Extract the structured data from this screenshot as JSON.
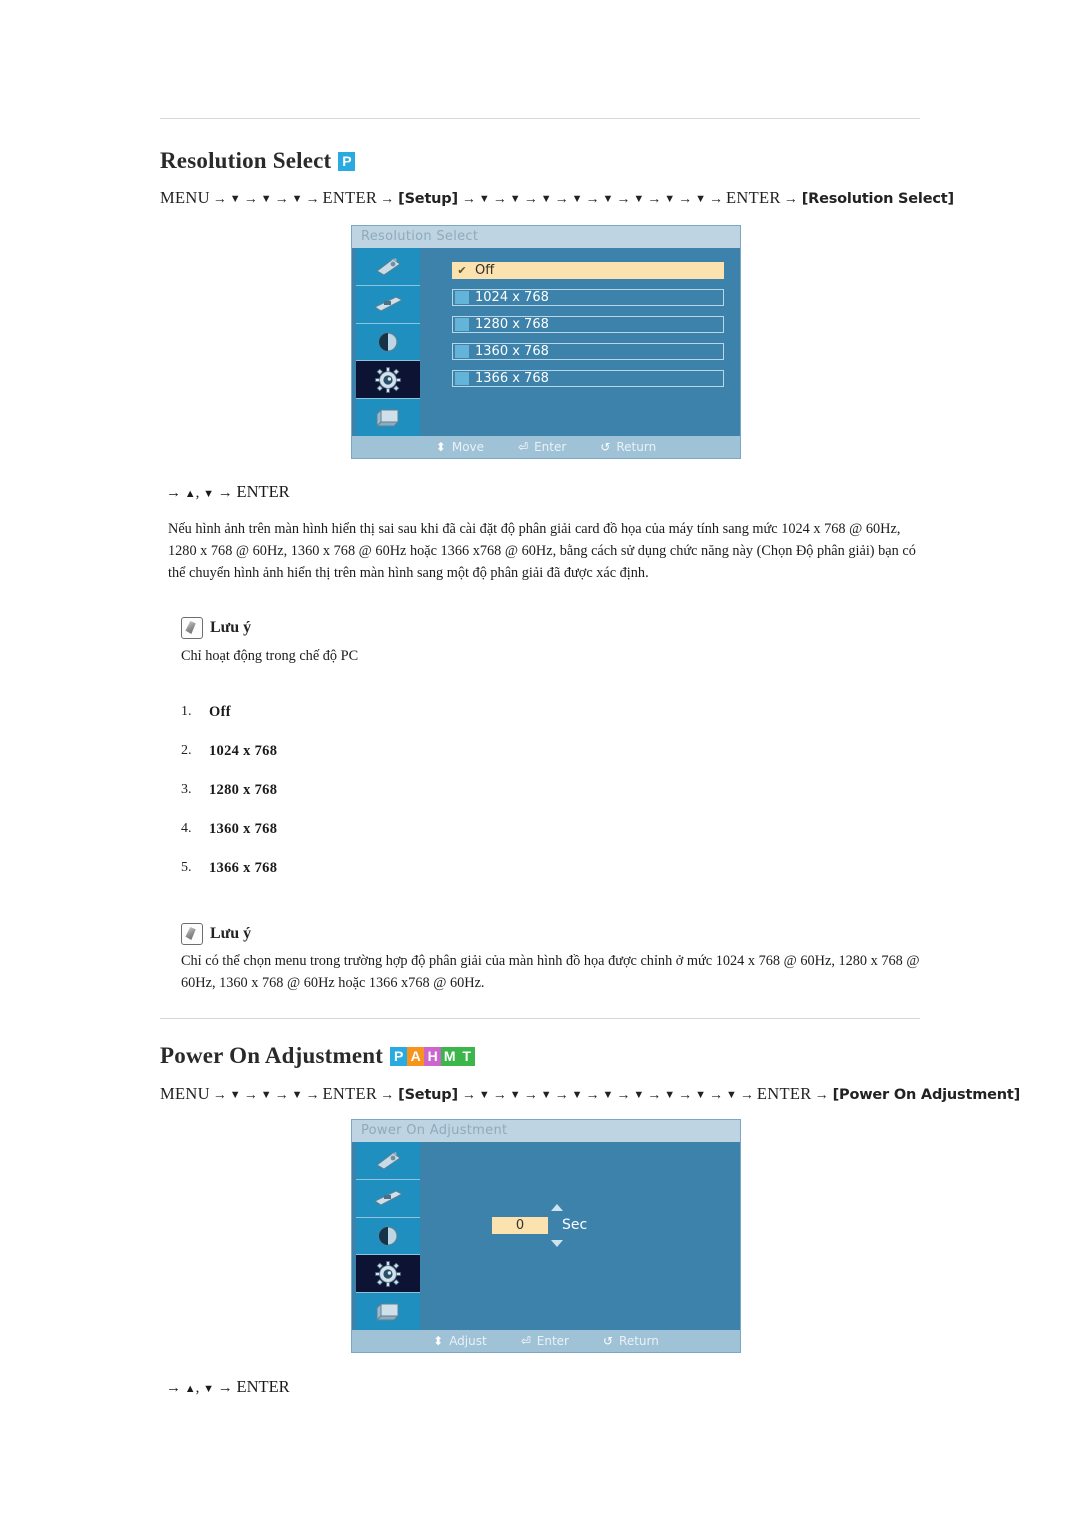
{
  "sections": [
    {
      "id": "resolution-select",
      "title": "Resolution Select",
      "badges": [
        {
          "letter": "P",
          "color": "#29abe2"
        }
      ],
      "nav": {
        "menu": "MENU",
        "enter": "ENTER",
        "setup_token": "[Setup]",
        "target_token": "[Resolution Select]",
        "lead_down_arrows": 3,
        "mid_down_arrows": 8
      },
      "osd": {
        "title": "Resolution Select",
        "sidebar_icons": [
          "picture-icon",
          "display-icon",
          "contrast-icon",
          "setup-gear-icon",
          "multi-control-icon"
        ],
        "active_icon_index": 3,
        "options": [
          {
            "label": "Off",
            "selected": true
          },
          {
            "label": "1024 x 768",
            "selected": false
          },
          {
            "label": "1280 x 768",
            "selected": false
          },
          {
            "label": "1360 x 768",
            "selected": false
          },
          {
            "label": "1366 x 768",
            "selected": false
          }
        ],
        "footer": [
          {
            "glyph": "move-updown-icon",
            "label": "Move"
          },
          {
            "glyph": "enter-key-icon",
            "label": "Enter"
          },
          {
            "glyph": "return-arrow-icon",
            "label": "Return"
          }
        ]
      },
      "small_nav": {
        "prefix": "→",
        "up": "▲",
        "comma": ",",
        "down": "▼",
        "arrow": "→",
        "enter": "ENTER"
      },
      "paragraph": "Nếu hình ảnh trên màn hình hiển thị sai sau khi đã cài đặt độ phân giải card đồ họa của máy tính sang mức 1024 x 768 @ 60Hz, 1280 x 768 @ 60Hz, 1360 x 768 @ 60Hz hoặc 1366 x768 @ 60Hz, bằng cách sử dụng chức năng này (Chọn Độ phân giải) bạn có thể chuyển hình ảnh hiển thị trên màn hình sang một độ phân giải đã được xác định.",
      "note1": {
        "label": "Lưu ý",
        "text": "Chỉ hoạt động trong chế độ PC"
      },
      "list": [
        {
          "index": "1.",
          "value": "Off"
        },
        {
          "index": "2.",
          "value": "1024 x 768"
        },
        {
          "index": "3.",
          "value": "1280 x 768"
        },
        {
          "index": "4.",
          "value": "1360 x 768"
        },
        {
          "index": "5.",
          "value": "1366 x 768"
        }
      ],
      "note2": {
        "label": "Lưu ý",
        "text": "Chỉ có thể chọn menu trong trường hợp độ phân giải của màn hình đồ họa được chỉnh ở mức 1024 x 768 @ 60Hz, 1280 x 768 @ 60Hz, 1360 x 768 @ 60Hz hoặc 1366 x768 @ 60Hz."
      }
    },
    {
      "id": "power-on-adjustment",
      "title": "Power On Adjustment",
      "badges": [
        {
          "letter": "P",
          "color": "#29abe2"
        },
        {
          "letter": "A",
          "color": "#f7941e"
        },
        {
          "letter": "H",
          "color": "#cc66cc"
        },
        {
          "letter": "M",
          "color": "#3cb54a"
        },
        {
          "letter": "T",
          "color": "#3cb54a"
        }
      ],
      "nav": {
        "menu": "MENU",
        "enter": "ENTER",
        "setup_token": "[Setup]",
        "target_token": "[Power On Adjustment]",
        "lead_down_arrows": 3,
        "mid_down_arrows": 9
      },
      "osd": {
        "title": "Power On Adjustment",
        "sidebar_icons": [
          "picture-icon",
          "display-icon",
          "contrast-icon",
          "setup-gear-icon",
          "multi-control-icon"
        ],
        "active_icon_index": 3,
        "spinner": {
          "value": "0",
          "unit": "Sec"
        },
        "footer": [
          {
            "glyph": "adjust-updown-icon",
            "label": "Adjust"
          },
          {
            "glyph": "enter-key-icon",
            "label": "Enter"
          },
          {
            "glyph": "return-arrow-icon",
            "label": "Return"
          }
        ]
      },
      "small_nav": {
        "prefix": "→",
        "up": "▲",
        "comma": ",",
        "down": "▼",
        "arrow": "→",
        "enter": "ENTER"
      }
    }
  ],
  "glyphs": {
    "right_arrow": "→",
    "down_triangle": "▼",
    "up_triangle": "▲",
    "check": "✔"
  }
}
